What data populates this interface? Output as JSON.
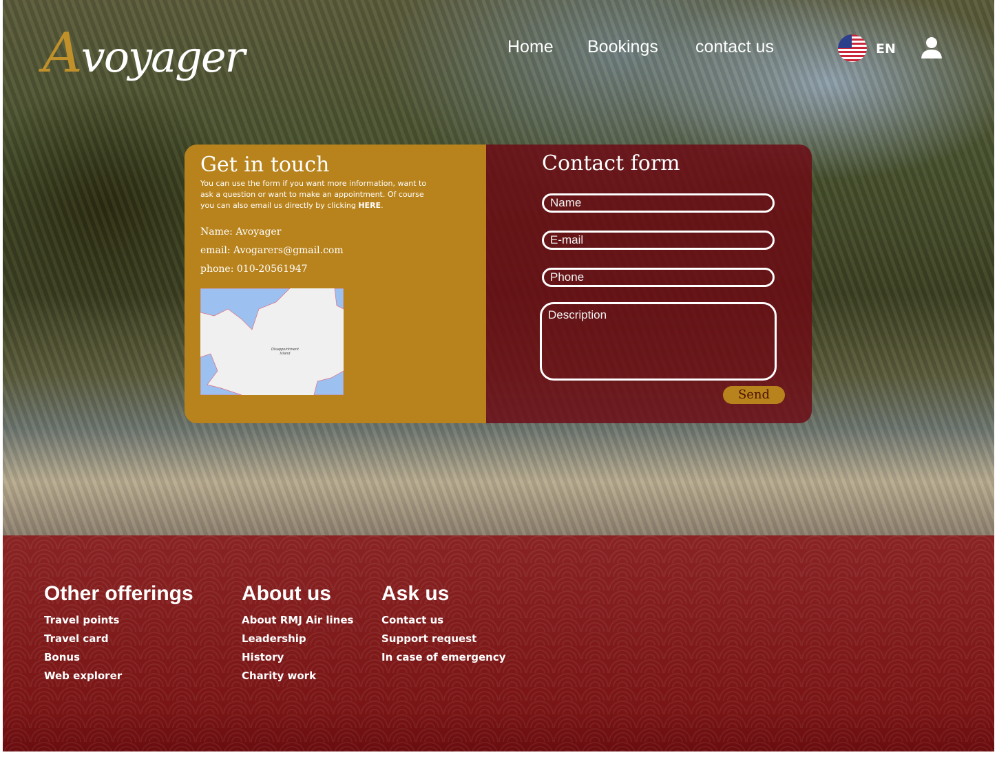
{
  "header": {
    "logo": "Avoyager",
    "logo_initial": "A",
    "logo_rest": "voyager",
    "nav": [
      "Home",
      "Bookings",
      "contact us"
    ],
    "language": "EN"
  },
  "get_in_touch": {
    "title": "Get in touch",
    "intro": "You can use the form if you want more information, want to ask a question or want to make an appointment. Of course you can also email us directly by clicking ",
    "link": "HERE",
    "intro_end": ".",
    "name": "Name: Avoyager",
    "email": "email:  Avogarers@gmail.com",
    "phone": "phone: 010-20561947",
    "map_label": "Disappointment Island"
  },
  "contact_form": {
    "title": "Contact form",
    "name_placeholder": "Name",
    "email_placeholder": "E-mail",
    "phone_placeholder": "Phone",
    "description_placeholder": "Description",
    "send": "Send"
  },
  "footer": {
    "columns": [
      {
        "title": "Other offerings",
        "items": [
          "Travel points",
          "Travel card",
          "Bonus",
          "Web explorer"
        ]
      },
      {
        "title": "About us",
        "items": [
          "About RMJ Air lines",
          "Leadership",
          "History",
          "Charity work"
        ]
      },
      {
        "title": "Ask us",
        "items": [
          "Contact us",
          "Support request",
          "In case of emergency"
        ]
      }
    ]
  }
}
